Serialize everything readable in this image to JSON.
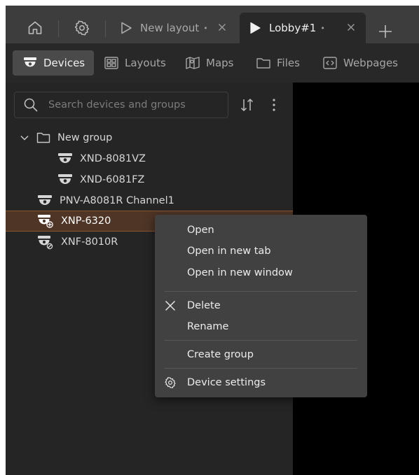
{
  "window": {
    "tabs": [
      {
        "label": "New layout",
        "modified_mark": "•",
        "active": false
      },
      {
        "label": "Lobby#1",
        "modified_mark": "•",
        "active": true
      }
    ],
    "icons": {
      "home": "home-icon",
      "settings": "gear-icon",
      "inactive_tab": "play-outline-icon",
      "active_tab": "play-filled-icon",
      "close": "close-icon",
      "add_tab": "plus-icon"
    }
  },
  "toolbar": {
    "items": [
      {
        "label": "Devices",
        "icon": "dome-camera-icon",
        "active": true
      },
      {
        "label": "Layouts",
        "icon": "layout-grid-icon",
        "active": false
      },
      {
        "label": "Maps",
        "icon": "map-icon",
        "active": false
      },
      {
        "label": "Files",
        "icon": "folder-icon",
        "active": false
      },
      {
        "label": "Webpages",
        "icon": "code-brackets-icon",
        "active": false
      }
    ]
  },
  "search": {
    "placeholder": "Search devices and groups",
    "value": ""
  },
  "device_tree": {
    "group": {
      "label": "New group",
      "expanded": true
    },
    "group_children": [
      {
        "label": "XND-8081VZ",
        "icon": "dome-camera-icon"
      },
      {
        "label": "XND-6081FZ",
        "icon": "dome-camera-icon"
      }
    ],
    "devices": [
      {
        "label": "PNV-A8081R Channel1",
        "icon": "dome-camera-icon",
        "selected": false
      },
      {
        "label": "XNP-6320",
        "icon": "ptz-camera-icon",
        "selected": true
      },
      {
        "label": "XNF-8010R",
        "icon": "fisheye-camera-icon",
        "selected": false
      }
    ]
  },
  "context_menu": {
    "items": [
      {
        "label": "Open"
      },
      {
        "label": "Open in new tab"
      },
      {
        "label": "Open in new window"
      },
      {
        "label": "Delete",
        "icon": "close-icon"
      },
      {
        "label": "Rename"
      },
      {
        "label": "Create group"
      },
      {
        "label": "Device settings",
        "icon": "gear-icon"
      }
    ]
  },
  "colors": {
    "chrome": "#3d3d3e",
    "panel": "#252526",
    "selection": "#4e3526",
    "selection_border": "#8a5630",
    "menu": "#414142"
  }
}
